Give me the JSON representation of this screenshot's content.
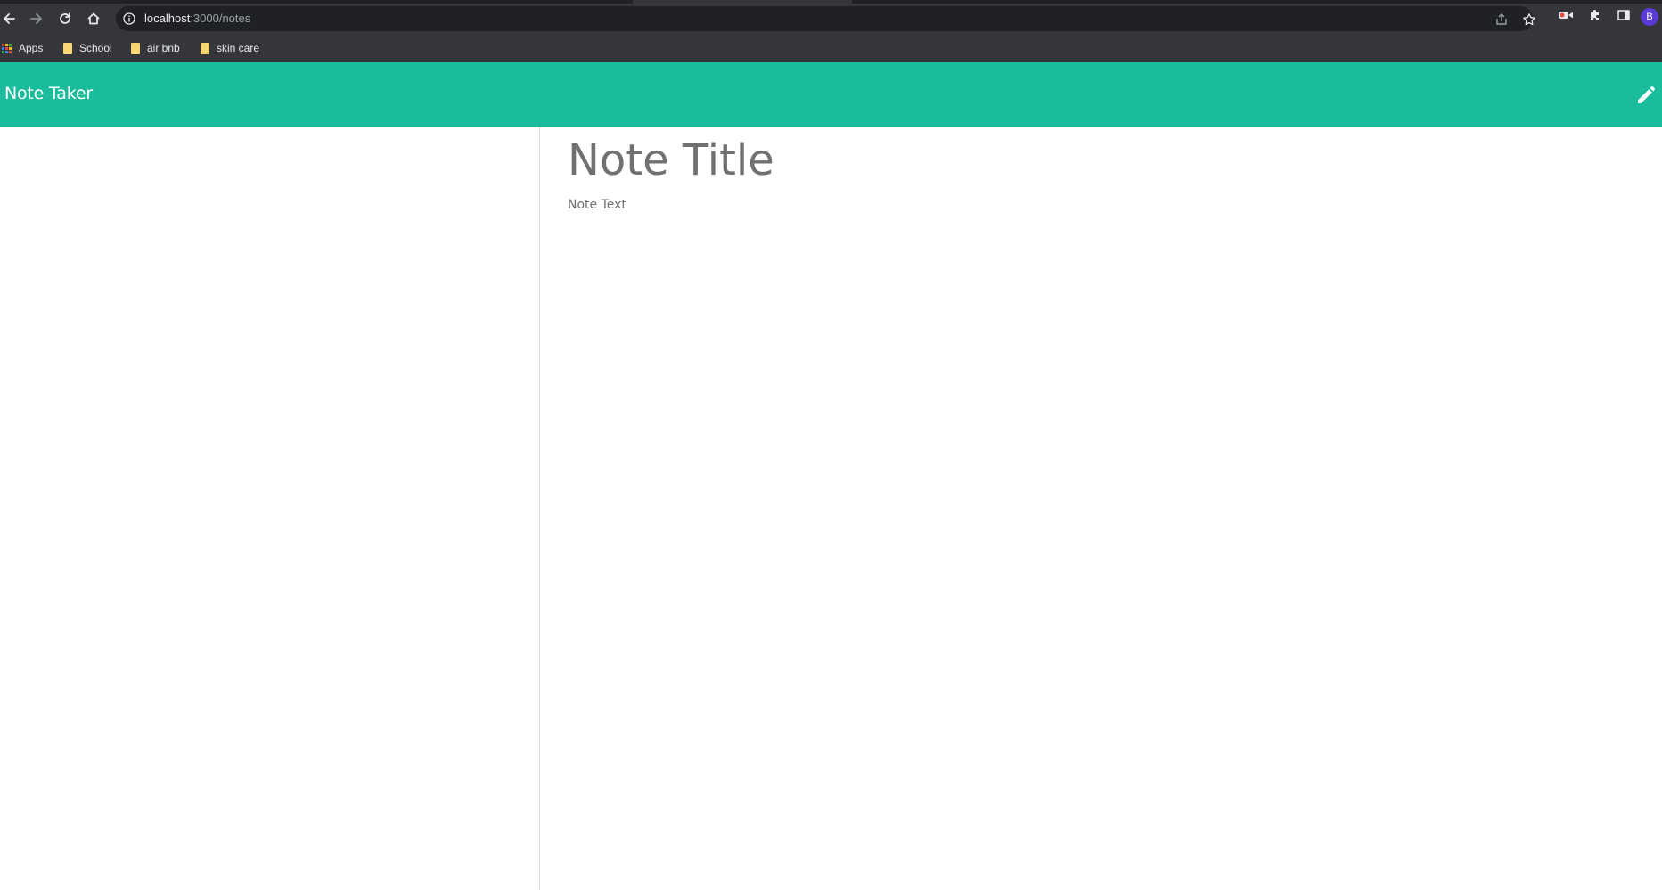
{
  "browser": {
    "url_host": "localhost",
    "url_path": ":3000/notes",
    "avatar_letter": "B",
    "bookmarks": [
      {
        "label": "Apps",
        "icon": "apps-grid-icon"
      },
      {
        "label": "School",
        "icon": "folder-icon"
      },
      {
        "label": "air bnb",
        "icon": "folder-icon"
      },
      {
        "label": "skin care",
        "icon": "folder-icon"
      }
    ]
  },
  "app": {
    "brand": "Note Taker",
    "accent_color": "#1abc9c",
    "new_note_icon": "pencil-icon",
    "note_title_placeholder": "Note Title",
    "note_text_placeholder": "Note Text"
  }
}
